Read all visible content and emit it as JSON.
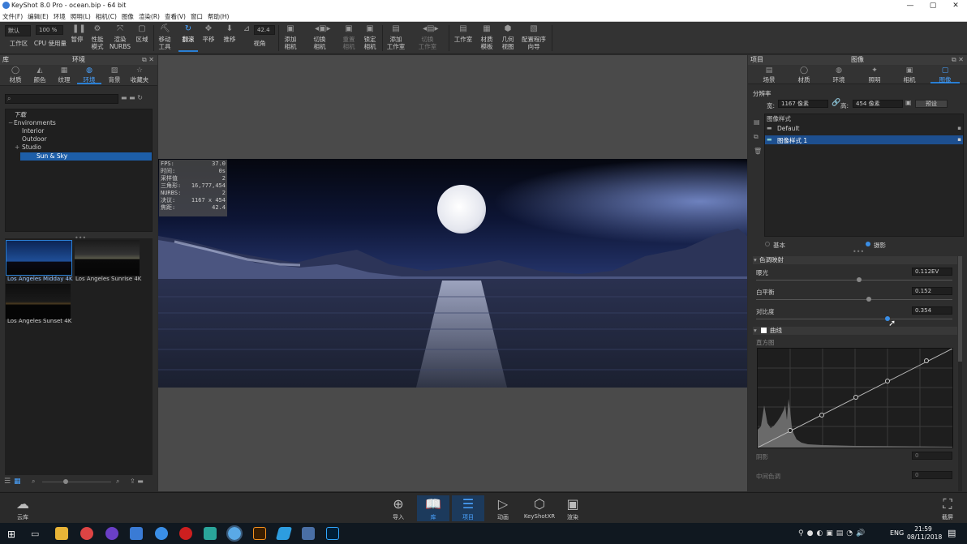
{
  "window": {
    "title": "KeyShot 8.0 Pro  -  ocean.bip  -  64 bit",
    "minimize": "—",
    "maximize": "▢",
    "close": "✕"
  },
  "menu": [
    "文件(F)",
    "编辑(E)",
    "环境",
    "照明(L)",
    "相机(C)",
    "图像",
    "渲染(R)",
    "查看(V)",
    "窗口",
    "帮助(H)"
  ],
  "toolbar": {
    "preset_value": "默认",
    "percent_value": "100 %",
    "fov_value": "42.4",
    "items": {
      "workspace": "工作区",
      "cpu": "CPU 使用量",
      "pause": "暂停",
      "perf1": "性能",
      "perf2": "模式",
      "render1": "渲染",
      "render2": "NURBS",
      "region": "区域",
      "move1": "移动",
      "move2": "工具",
      "tumble": "翻滚",
      "pan": "平移",
      "dolly": "推移",
      "fov": "视角",
      "addcam1": "添加",
      "addcam2": "相机",
      "switchcam1": "切换",
      "switchcam2": "相机",
      "resetcam1": "重置",
      "resetcam2": "相机",
      "lockcam1": "锁定",
      "lockcam2": "相机",
      "addstudio1": "添加",
      "addstudio2": "工作室",
      "switchstudio1": "切换",
      "switchstudio2": "工作室",
      "studio": "工作室",
      "mattemp1": "材质",
      "mattemp2": "模板",
      "geo1": "几何",
      "geo2": "视图",
      "wizard1": "配置程序",
      "wizard2": "向导"
    }
  },
  "library": {
    "panel_left": "库",
    "title": "环境",
    "tabs": [
      "材质",
      "颜色",
      "纹理",
      "环境",
      "背景",
      "收藏夹"
    ],
    "tree": [
      {
        "label": "下载",
        "indent": 1,
        "italic": true
      },
      {
        "label": "Environments",
        "indent": 1,
        "prefix": "−"
      },
      {
        "label": "Interior",
        "indent": 3
      },
      {
        "label": "Outdoor",
        "indent": 3
      },
      {
        "label": "Studio",
        "indent": 3,
        "prefix": "+"
      },
      {
        "label": "Sun & Sky",
        "indent": 3,
        "selected": true
      }
    ],
    "thumbs": [
      "Los Angeles Midday 4K",
      "Los Angeles Sunrise 4K",
      "Los Angeles Sunset 4K"
    ]
  },
  "stats": [
    [
      "FPS:",
      "37.0"
    ],
    [
      "时间:",
      "0s"
    ],
    [
      "采样值",
      "2"
    ],
    [
      "三角形:",
      "16,777,454"
    ],
    [
      "NURBS:",
      "2"
    ],
    [
      "决议:",
      "1167 x 454"
    ],
    [
      "焦距:",
      "42.4"
    ]
  ],
  "project": {
    "panel_left": "项目",
    "title": "图像",
    "tabs": [
      "场景",
      "材质",
      "环境",
      "照明",
      "相机",
      "图像"
    ],
    "resolution_label": "分辨率",
    "width_label": "宽:",
    "width_value": "1167 像素",
    "height_label": "高:",
    "height_value": "454 像素",
    "preset_button": "预设",
    "styles_header": "图像样式",
    "styles": [
      "Default",
      "图像样式 1"
    ],
    "mode_basic": "基本",
    "mode_photo": "摄影",
    "tonemap_header": "色调映射",
    "exposure_label": "曝光",
    "exposure_value": "0.112EV",
    "wb_label": "白平衡",
    "wb_value": "0.152",
    "contrast_label": "对比度",
    "contrast_value": "0.354",
    "curves_header": "曲线",
    "histogram_label": "直方图",
    "shadows_label": "阴影",
    "shadows_value": "0",
    "midtones_label": "中间色调",
    "midtones_value": "0"
  },
  "bottom": {
    "cloud": "云库",
    "items": [
      "导入",
      "库",
      "项目",
      "动画",
      "KeyShotXR",
      "渲染"
    ],
    "screenshot": "截屏"
  },
  "taskbar": {
    "lang": "ENG",
    "time": "21:59",
    "date": "08/11/2018"
  }
}
